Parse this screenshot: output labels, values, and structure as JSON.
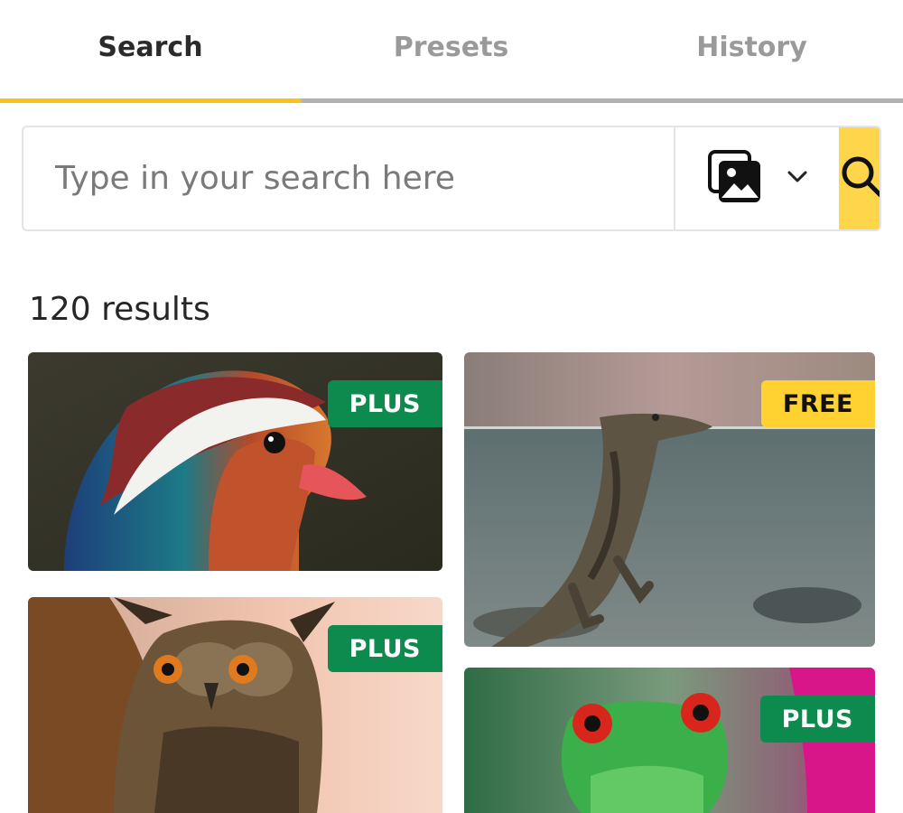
{
  "tabs": [
    {
      "label": "Search",
      "active": true
    },
    {
      "label": "Presets",
      "active": false
    },
    {
      "label": "History",
      "active": false
    }
  ],
  "search": {
    "placeholder": "Type in your search here",
    "value": "",
    "type_icon": "images-icon",
    "dropdown_icon": "chevron-down-icon",
    "button_icon": "search-icon"
  },
  "results": {
    "count_text": "120 results",
    "items": [
      {
        "subject": "mandarin duck",
        "badge": "PLUS"
      },
      {
        "subject": "crocodile",
        "badge": "FREE"
      },
      {
        "subject": "owl",
        "badge": "PLUS"
      },
      {
        "subject": "tree frog",
        "badge": "PLUS"
      }
    ]
  },
  "colors": {
    "accent": "#f8c21c",
    "search_button": "#ffd54a",
    "plus_badge": "#0d8a4e",
    "free_badge": "#ffd231"
  }
}
